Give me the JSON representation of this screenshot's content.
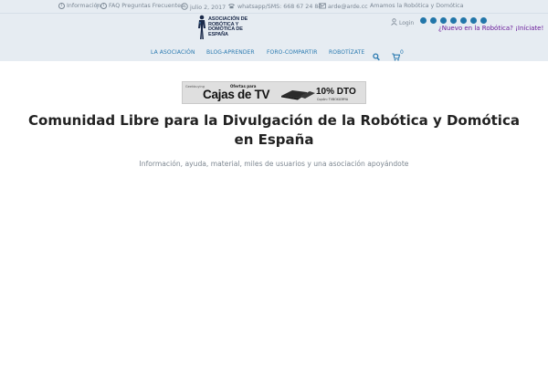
{
  "topbar": {
    "informacion": "Información",
    "faq": "FAQ Preguntas Frecuentes",
    "date": "julio 2, 2017",
    "phone": "whatsapp/SMS: 668 67 24 84",
    "email": "arde@arde.cc",
    "tagline": "Amamos la Robótica y Domótica"
  },
  "logo": {
    "text_line1": "ASOCIACIÓN DE",
    "text_line2": "ROBÓTICA Y",
    "text_line3": "DOMÓTICA DE",
    "text_line4": "ESPAÑA"
  },
  "header": {
    "login": "Login",
    "nuevo": "¿Nuevo en la Robótica? ¡Iníciate!",
    "cart_count": "0",
    "socials": [
      "facebook-icon",
      "twitter-icon",
      "google-plus-icon",
      "youtube-icon",
      "linkedin-icon",
      "pinterest-icon",
      "telegram-icon"
    ],
    "social_color": "#2276a9"
  },
  "nav": {
    "item1": "LA ASOCIACIÓN",
    "item2": "BLOG-APRENDER",
    "item3": "FORO-COMPARTIR",
    "item4": "ROBOTÍZATE"
  },
  "banner": {
    "brand": "Geekbuying",
    "offer": "Ofertas para",
    "title": "Cajas de TV",
    "discount": "10% DTO",
    "coupon": "Cupón: TVBOX03RYA"
  },
  "main": {
    "title": "Comunidad Libre para la Divulgación de la Robótica y Domótica en España",
    "subtitle": "Información, ayuda, material, miles de usuarios y una asociación apoyándote"
  },
  "colors": {
    "header_bg": "#e6ecf2",
    "nav_link": "#2a7ab0",
    "nuevo_link": "#6a1b9a"
  }
}
